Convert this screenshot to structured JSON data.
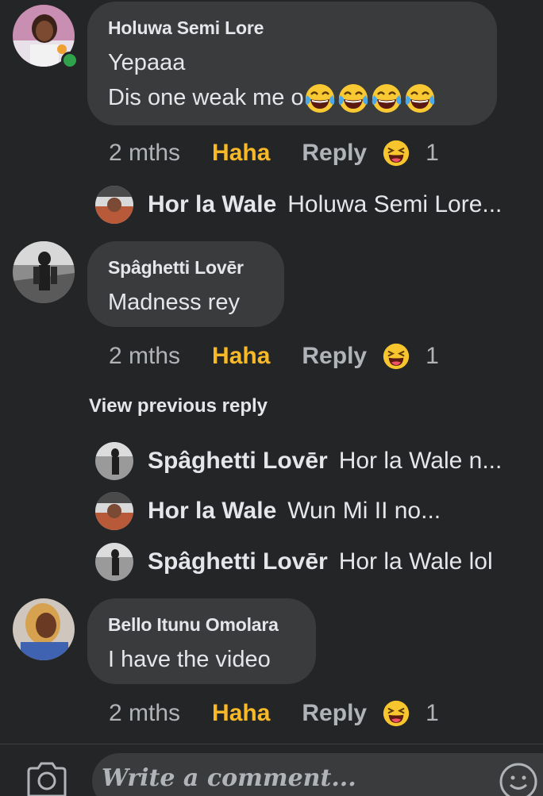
{
  "comments": [
    {
      "author": "Holuwa Semi Lore",
      "text_line1": "Yepaaa",
      "text_line2": "Dis one weak me o",
      "emoji_count": 4,
      "time": "2 mths",
      "reaction_label": "Haha",
      "reply_label": "Reply",
      "reaction_count": "1",
      "online": true
    },
    {
      "author": "Spâghetti Lovēr",
      "text": "Madness rey",
      "time": "2 mths",
      "reaction_label": "Haha",
      "reply_label": "Reply",
      "reaction_count": "1"
    },
    {
      "author": "Bello Itunu Omolara",
      "text": "I have the video",
      "time": "2 mths",
      "reaction_label": "Haha",
      "reply_label": "Reply",
      "reaction_count": "1"
    }
  ],
  "replies_first": [
    {
      "name": "Hor la Wale",
      "text": "Holuwa Semi Lore..."
    }
  ],
  "view_previous": "View previous reply",
  "replies_second": [
    {
      "name": "Spâghetti Lovēr",
      "text": "Hor la Wale n..."
    },
    {
      "name": "Hor la Wale",
      "text": "Wun Mi II no..."
    },
    {
      "name": "Spâghetti Lovēr",
      "text": "Hor la Wale lol"
    }
  ],
  "composer": {
    "placeholder": "Write a comment...",
    "camera_icon": "camera-icon",
    "emoji_icon": "smiley-icon"
  },
  "colors": {
    "background": "#242526",
    "bubble": "#3a3b3c",
    "haha": "#f7b928",
    "muted": "#b0b3b8",
    "online": "#31a24c"
  }
}
